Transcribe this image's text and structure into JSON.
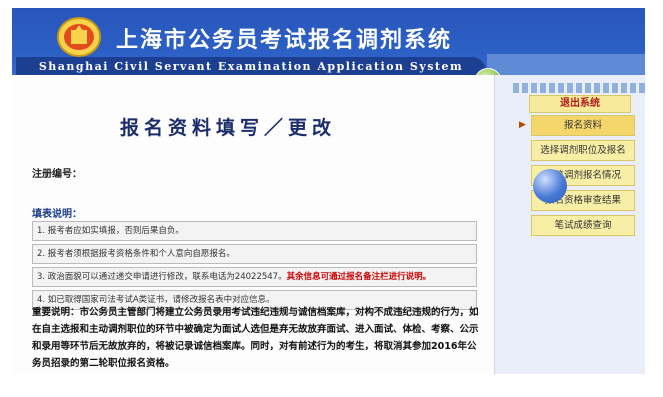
{
  "header": {
    "title_cn": "上海市公务员考试报名调剂系统",
    "title_en": "Shanghai Civil Servant Examination Application System",
    "logo_icon": "civil-service-emblem-icon",
    "accent": "#2b5fc4"
  },
  "page": {
    "title": "报名资料填写／更改",
    "reg_label": "注册编号：",
    "notes_title": "填表说明：",
    "notes": [
      {
        "text": "1. 报考者应如实填报，否则后果自负。"
      },
      {
        "text": "2. 报考者须根据报考资格条件和个人意向自愿报名。"
      },
      {
        "text": "3. 政治面貌可以通过递交申请进行修改，联系电话为24022547。",
        "red": "其余信息可通过报名备注栏进行说明。"
      },
      {
        "text": "4. 如已取得国家司法考试A类证书，请修改报名表中对应信息。"
      }
    ],
    "important": "重要说明：市公务员主管部门将建立公务员录用考试违纪违规与诚信档案库，对构不成违纪违规的行为，如在自主选报和主动调剂职位的环节中被确定为面试人选但是弃无故放弃面试、进入面试、体检、考察、公示和录用等环节后无故放弃的，将被记录诚信档案库。同时，对有前述行为的考生，将取消其参加2016年公务员招录的第二轮职位报名资格。"
  },
  "sidebar": {
    "exit_label": "退出系统",
    "items": [
      {
        "label": "报名资料",
        "active": true
      },
      {
        "label": "选择调剂职位及报名",
        "active": false
      },
      {
        "label": "浏览调剂报名情况",
        "active": false
      },
      {
        "label": "报名资格审查结果",
        "active": false
      },
      {
        "label": "笔试成绩查询",
        "active": false
      }
    ]
  }
}
